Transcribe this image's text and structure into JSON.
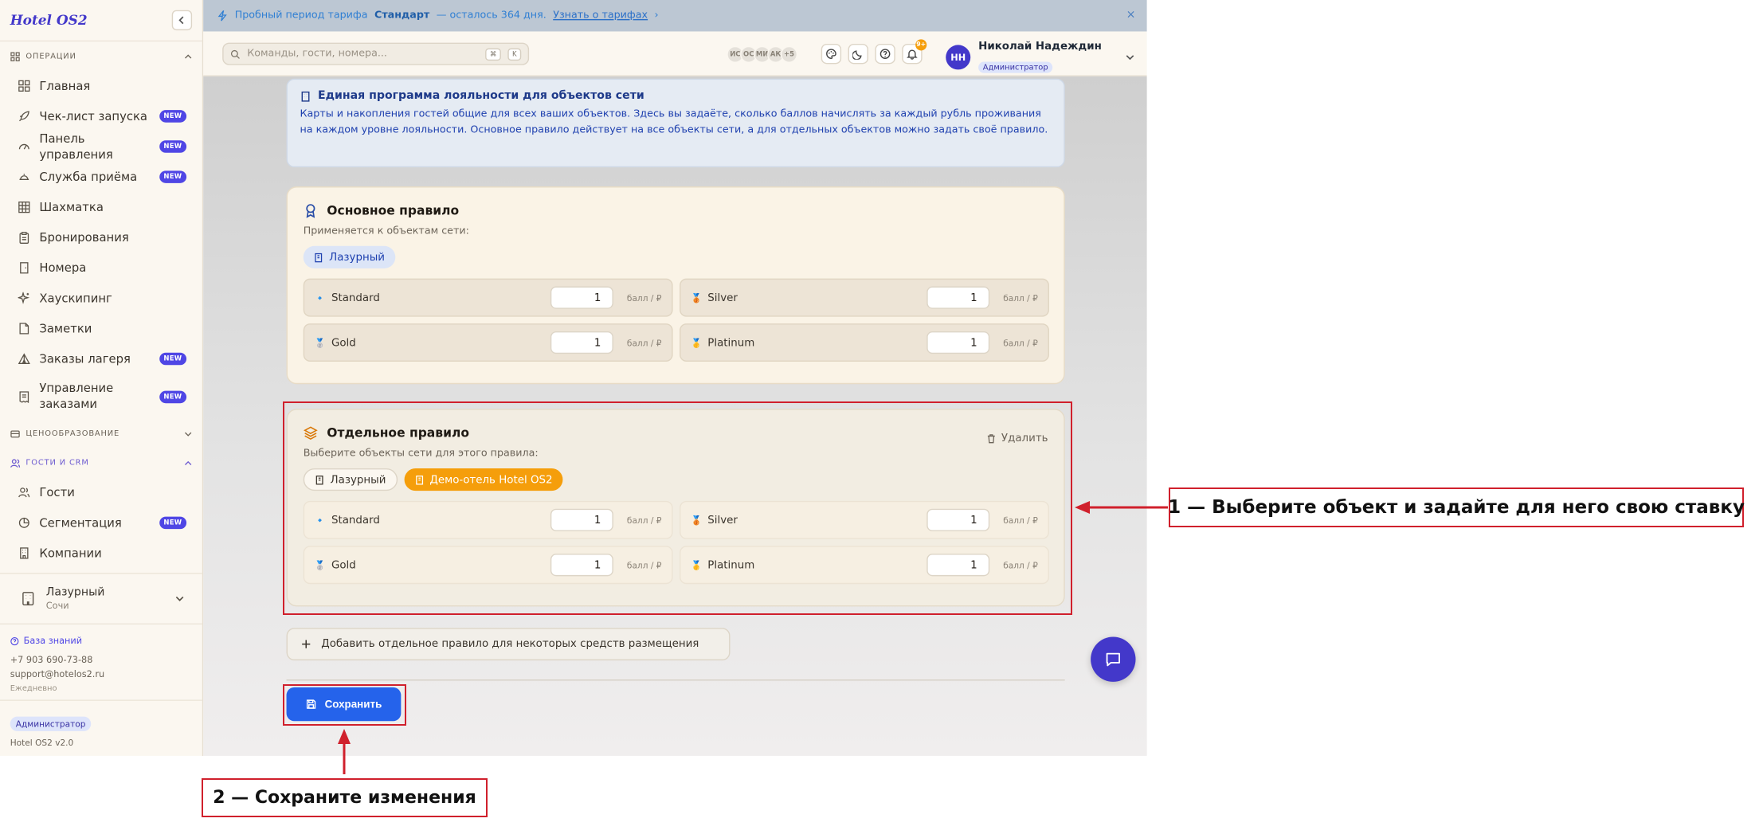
{
  "app": {
    "logo": "Hotel OS2",
    "version": "Hotel OS2 v2.0"
  },
  "banner": {
    "text_before": "Пробный период тарифа",
    "plan": "Стандарт",
    "text_after": "— осталось 364 дня.",
    "link": "Узнать о тарифах",
    "chevron": "›",
    "close": "×"
  },
  "search": {
    "placeholder": "Команды, гости, номера...",
    "key1": "⌘",
    "key2": "K"
  },
  "presence": [
    "ИС",
    "ОС",
    "МИ",
    "АК",
    "+5"
  ],
  "notifications": {
    "count": "9+"
  },
  "user": {
    "initials": "НН",
    "name": "Николай Надеждин",
    "role": "Администратор"
  },
  "sidebar": {
    "operations_title": "Операции",
    "operations": [
      {
        "label": "Главная",
        "icon": "dashboard-icon",
        "badge": ""
      },
      {
        "label": "Чек-лист запуска",
        "icon": "rocket-icon",
        "badge": "NEW"
      },
      {
        "label": "Панель управления",
        "icon": "gauge-icon",
        "badge": "NEW"
      },
      {
        "label": "Служба приёма",
        "icon": "bell-service-icon",
        "badge": "NEW"
      },
      {
        "label": "Шахматка",
        "icon": "grid-icon",
        "badge": ""
      },
      {
        "label": "Бронирования",
        "icon": "clipboard-icon",
        "badge": ""
      },
      {
        "label": "Номера",
        "icon": "door-icon",
        "badge": ""
      },
      {
        "label": "Хаускипинг",
        "icon": "sparkles-icon",
        "badge": ""
      },
      {
        "label": "Заметки",
        "icon": "note-icon",
        "badge": ""
      },
      {
        "label": "Заказы лагеря",
        "icon": "tent-icon",
        "badge": "NEW"
      },
      {
        "label": "Управление заказами",
        "icon": "receipt-icon",
        "badge": "NEW"
      }
    ],
    "pricing_title": "Ценообразование",
    "guests_title": "Гости и CRM",
    "guests": [
      {
        "label": "Гости",
        "icon": "users-icon",
        "badge": ""
      },
      {
        "label": "Сегментация",
        "icon": "pie-icon",
        "badge": "NEW"
      },
      {
        "label": "Компании",
        "icon": "building-icon",
        "badge": ""
      }
    ],
    "property": {
      "name": "Лазурный",
      "city": "Сочи"
    },
    "kb": {
      "link": "База знаний",
      "phone": "+7 903 690-73-88",
      "email": "support@hotelos2.ru",
      "hours": "Ежедневно"
    },
    "footer_role": "Администратор"
  },
  "info": {
    "title": "Единая программа лояльности для объектов сети",
    "text": "Карты и накопления гостей общие для всех ваших объектов. Здесь вы задаёте, сколько баллов начислять за каждый рубль проживания на каждом уровне лояльности. Основное правило действует на все объекты сети, а для отдельных объектов можно задать своё правило."
  },
  "base_rule": {
    "title": "Основное правило",
    "subtitle": "Применяется к объектам сети:",
    "chip": "Лазурный",
    "tiers": [
      {
        "medal": "🔹",
        "name": "Standard",
        "value": "1",
        "unit": "балл / ₽"
      },
      {
        "medal": "🥉",
        "name": "Silver",
        "value": "1",
        "unit": "балл / ₽"
      },
      {
        "medal": "🥈",
        "name": "Gold",
        "value": "1",
        "unit": "балл / ₽"
      },
      {
        "medal": "🥇",
        "name": "Platinum",
        "value": "1",
        "unit": "балл / ₽"
      }
    ]
  },
  "separate_rule": {
    "title": "Отдельное правило",
    "delete": "Удалить",
    "subtitle": "Выберите объекты сети для этого правила:",
    "chips": [
      "Лазурный",
      "Демо-отель Hotel OS2"
    ],
    "tiers": [
      {
        "medal": "🔹",
        "name": "Standard",
        "value": "1",
        "unit": "балл / ₽"
      },
      {
        "medal": "🥉",
        "name": "Silver",
        "value": "1",
        "unit": "балл / ₽"
      },
      {
        "medal": "🥈",
        "name": "Gold",
        "value": "1",
        "unit": "балл / ₽"
      },
      {
        "medal": "🥇",
        "name": "Platinum",
        "value": "1",
        "unit": "балл / ₽"
      }
    ]
  },
  "add_rule": "Добавить отдельное правило для некоторых средств размещения",
  "save": "Сохранить",
  "annotations": {
    "step1": "1 — Выберите объект и задайте для него свою ставку",
    "step2": "2 — Сохраните изменения",
    "color": "#d0202c"
  },
  "colors": {
    "accent": "#4f46e5",
    "primary": "#2563eb",
    "orange": "#f59e0b"
  }
}
